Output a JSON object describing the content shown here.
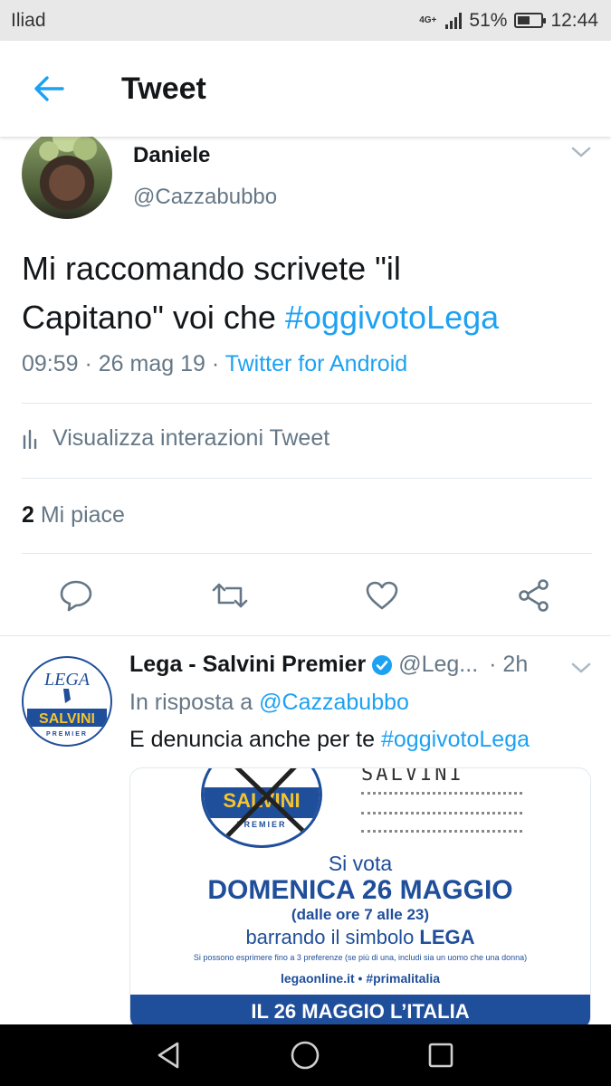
{
  "status_bar": {
    "carrier": "Iliad",
    "network": "4G+",
    "battery": "51%",
    "battery_level": 0.51,
    "time": "12:44"
  },
  "header": {
    "title": "Tweet",
    "back_icon": "arrow-left-icon"
  },
  "tweet": {
    "author_name": "Daniele",
    "author_handle": "@Cazzabubbo",
    "text_line1": "Mi raccomando scrivete \"il",
    "text_line2_plain": "Capitano\" voi che ",
    "hashtag": "#oggivotoLega",
    "time": "09:59 · 26 mag 19 · ",
    "source": "Twitter for Android",
    "interactions_label": "Visualizza interazioni Tweet",
    "likes_count": "2",
    "likes_label": " Mi piace"
  },
  "actions": {
    "reply_icon": "comment-icon",
    "retweet_icon": "retweet-icon",
    "like_icon": "heart-icon",
    "share_icon": "share-icon"
  },
  "reply": {
    "name": "Lega - Salvini Premier",
    "handle": "@Leg...",
    "time": "· 2h",
    "in_reply_to_label": "In risposta a ",
    "in_reply_to_handle": "@Cazzabubbo",
    "text_plain": "E denuncia anche per te ",
    "hashtag": "#oggivotoLega",
    "avatar_logo_text": "LEGA",
    "avatar_band_text": "SALVINI",
    "avatar_sub_text": "PREMIER"
  },
  "media": {
    "logo_text": "SALVINI",
    "logo_sub": "PREMIER",
    "handwritten": "SALVINI",
    "line1": "Si vota",
    "line2": "DOMENICA 26 MAGGIO",
    "line3": "(dalle ore 7 alle 23)",
    "line4_plain": "barrando il simbolo ",
    "line4_bold": "LEGA",
    "line5": "Si possono esprimere fino a 3 preferenze (se più di una, includi sia un uomo che una donna)",
    "line6": "legaonline.it • #primalitalia",
    "banner": "IL 26 MAGGIO L’ITALIA"
  },
  "colors": {
    "accent": "#1da1f2",
    "secondary_text": "#657786",
    "lega_blue": "#1f4e9a"
  }
}
